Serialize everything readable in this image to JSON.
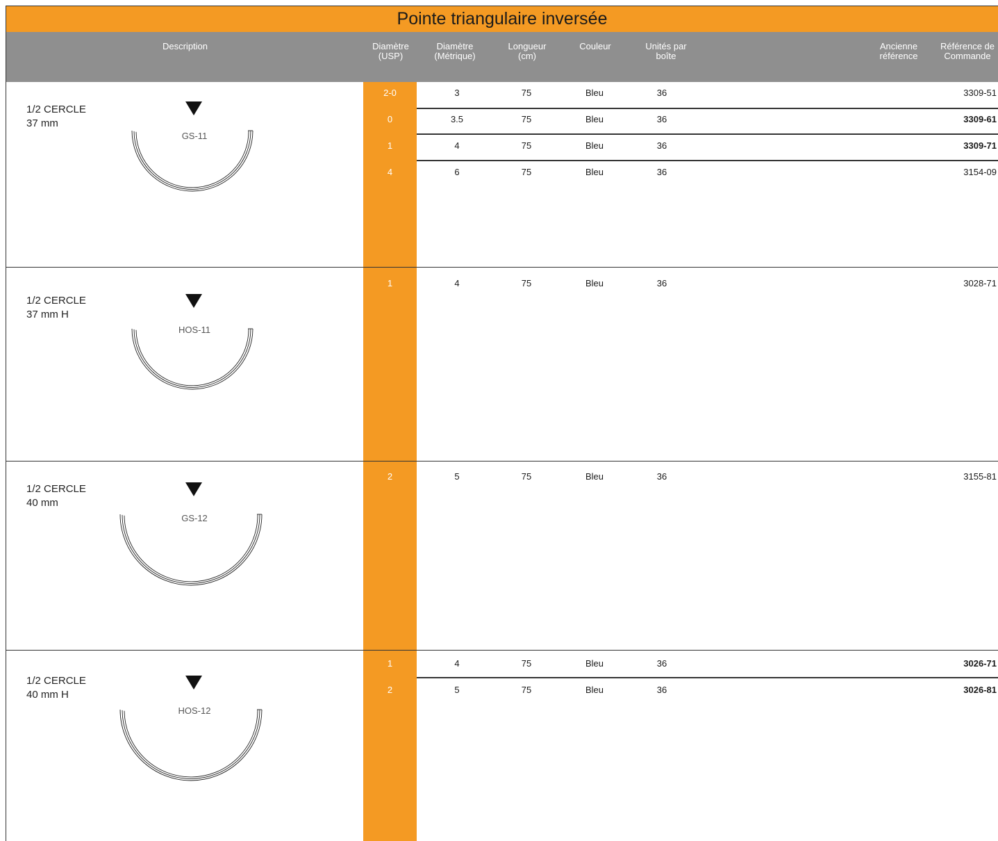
{
  "title": "Pointe triangulaire inversée",
  "headers": {
    "description": "Description",
    "usp_1": "Diamètre",
    "usp_2": "(USP)",
    "metric_1": "Diamètre",
    "metric_2": "(Métrique)",
    "length_1": "Longueur",
    "length_2": "(cm)",
    "color": "Couleur",
    "units_1": "Unités par",
    "units_2": "boîte",
    "old_1": "Ancienne",
    "old_2": "référence",
    "ref_1": "Référence de",
    "ref_2": "Commande"
  },
  "sections": [
    {
      "desc_1": "1/2 CERCLE",
      "desc_2": "37 mm",
      "code": "GS-11",
      "rows": [
        {
          "usp": "2-0",
          "metric": "3",
          "length": "75",
          "color": "Bleu",
          "units": "36",
          "ref": "3309-51",
          "bold": false
        },
        {
          "usp": "0",
          "metric": "3.5",
          "length": "75",
          "color": "Bleu",
          "units": "36",
          "ref": "3309-61",
          "bold": true
        },
        {
          "usp": "1",
          "metric": "4",
          "length": "75",
          "color": "Bleu",
          "units": "36",
          "ref": "3309-71",
          "bold": true
        },
        {
          "usp": "4",
          "metric": "6",
          "length": "75",
          "color": "Bleu",
          "units": "36",
          "ref": "3154-09",
          "bold": false
        }
      ]
    },
    {
      "desc_1": "1/2 CERCLE",
      "desc_2": "37 mm H",
      "code": "HOS-11",
      "rows": [
        {
          "usp": "1",
          "metric": "4",
          "length": "75",
          "color": "Bleu",
          "units": "36",
          "ref": "3028-71",
          "bold": false
        }
      ]
    },
    {
      "desc_1": "1/2 CERCLE",
      "desc_2": "40 mm",
      "code": "GS-12",
      "rows": [
        {
          "usp": "2",
          "metric": "5",
          "length": "75",
          "color": "Bleu",
          "units": "36",
          "ref": "3155-81",
          "bold": false
        }
      ]
    },
    {
      "desc_1": "1/2 CERCLE",
      "desc_2": "40 mm H",
      "code": "HOS-12",
      "rows": [
        {
          "usp": "1",
          "metric": "4",
          "length": "75",
          "color": "Bleu",
          "units": "36",
          "ref": "3026-71",
          "bold": true
        },
        {
          "usp": "2",
          "metric": "5",
          "length": "75",
          "color": "Bleu",
          "units": "36",
          "ref": "3026-81",
          "bold": true
        }
      ]
    }
  ]
}
